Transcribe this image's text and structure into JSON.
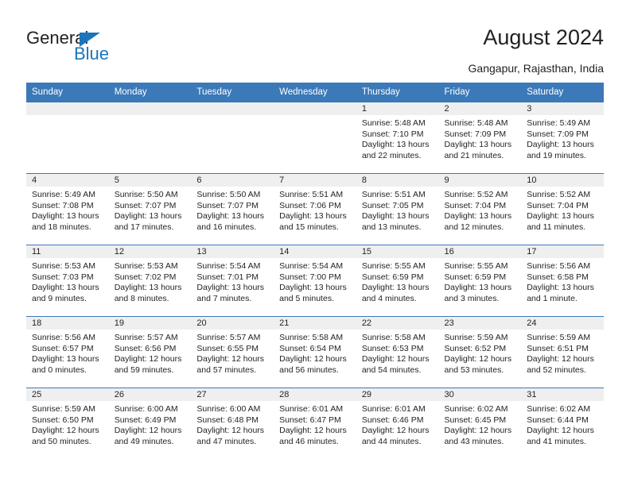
{
  "brand": {
    "name_top": "General",
    "name_bottom": "Blue",
    "accent_color": "#1b75bb"
  },
  "header": {
    "title": "August 2024",
    "subtitle": "Gangapur, Rajasthan, India"
  },
  "calendar": {
    "header_bg": "#3b79b8",
    "daynum_bg": "#efefef",
    "weekdays": [
      "Sunday",
      "Monday",
      "Tuesday",
      "Wednesday",
      "Thursday",
      "Friday",
      "Saturday"
    ],
    "weeks": [
      [
        {
          "day": "",
          "empty": true
        },
        {
          "day": "",
          "empty": true
        },
        {
          "day": "",
          "empty": true
        },
        {
          "day": "",
          "empty": true
        },
        {
          "day": "1",
          "sunrise": "Sunrise: 5:48 AM",
          "sunset": "Sunset: 7:10 PM",
          "daylight": "Daylight: 13 hours and 22 minutes."
        },
        {
          "day": "2",
          "sunrise": "Sunrise: 5:48 AM",
          "sunset": "Sunset: 7:09 PM",
          "daylight": "Daylight: 13 hours and 21 minutes."
        },
        {
          "day": "3",
          "sunrise": "Sunrise: 5:49 AM",
          "sunset": "Sunset: 7:09 PM",
          "daylight": "Daylight: 13 hours and 19 minutes."
        }
      ],
      [
        {
          "day": "4",
          "sunrise": "Sunrise: 5:49 AM",
          "sunset": "Sunset: 7:08 PM",
          "daylight": "Daylight: 13 hours and 18 minutes."
        },
        {
          "day": "5",
          "sunrise": "Sunrise: 5:50 AM",
          "sunset": "Sunset: 7:07 PM",
          "daylight": "Daylight: 13 hours and 17 minutes."
        },
        {
          "day": "6",
          "sunrise": "Sunrise: 5:50 AM",
          "sunset": "Sunset: 7:07 PM",
          "daylight": "Daylight: 13 hours and 16 minutes."
        },
        {
          "day": "7",
          "sunrise": "Sunrise: 5:51 AM",
          "sunset": "Sunset: 7:06 PM",
          "daylight": "Daylight: 13 hours and 15 minutes."
        },
        {
          "day": "8",
          "sunrise": "Sunrise: 5:51 AM",
          "sunset": "Sunset: 7:05 PM",
          "daylight": "Daylight: 13 hours and 13 minutes."
        },
        {
          "day": "9",
          "sunrise": "Sunrise: 5:52 AM",
          "sunset": "Sunset: 7:04 PM",
          "daylight": "Daylight: 13 hours and 12 minutes."
        },
        {
          "day": "10",
          "sunrise": "Sunrise: 5:52 AM",
          "sunset": "Sunset: 7:04 PM",
          "daylight": "Daylight: 13 hours and 11 minutes."
        }
      ],
      [
        {
          "day": "11",
          "sunrise": "Sunrise: 5:53 AM",
          "sunset": "Sunset: 7:03 PM",
          "daylight": "Daylight: 13 hours and 9 minutes."
        },
        {
          "day": "12",
          "sunrise": "Sunrise: 5:53 AM",
          "sunset": "Sunset: 7:02 PM",
          "daylight": "Daylight: 13 hours and 8 minutes."
        },
        {
          "day": "13",
          "sunrise": "Sunrise: 5:54 AM",
          "sunset": "Sunset: 7:01 PM",
          "daylight": "Daylight: 13 hours and 7 minutes."
        },
        {
          "day": "14",
          "sunrise": "Sunrise: 5:54 AM",
          "sunset": "Sunset: 7:00 PM",
          "daylight": "Daylight: 13 hours and 5 minutes."
        },
        {
          "day": "15",
          "sunrise": "Sunrise: 5:55 AM",
          "sunset": "Sunset: 6:59 PM",
          "daylight": "Daylight: 13 hours and 4 minutes."
        },
        {
          "day": "16",
          "sunrise": "Sunrise: 5:55 AM",
          "sunset": "Sunset: 6:59 PM",
          "daylight": "Daylight: 13 hours and 3 minutes."
        },
        {
          "day": "17",
          "sunrise": "Sunrise: 5:56 AM",
          "sunset": "Sunset: 6:58 PM",
          "daylight": "Daylight: 13 hours and 1 minute."
        }
      ],
      [
        {
          "day": "18",
          "sunrise": "Sunrise: 5:56 AM",
          "sunset": "Sunset: 6:57 PM",
          "daylight": "Daylight: 13 hours and 0 minutes."
        },
        {
          "day": "19",
          "sunrise": "Sunrise: 5:57 AM",
          "sunset": "Sunset: 6:56 PM",
          "daylight": "Daylight: 12 hours and 59 minutes."
        },
        {
          "day": "20",
          "sunrise": "Sunrise: 5:57 AM",
          "sunset": "Sunset: 6:55 PM",
          "daylight": "Daylight: 12 hours and 57 minutes."
        },
        {
          "day": "21",
          "sunrise": "Sunrise: 5:58 AM",
          "sunset": "Sunset: 6:54 PM",
          "daylight": "Daylight: 12 hours and 56 minutes."
        },
        {
          "day": "22",
          "sunrise": "Sunrise: 5:58 AM",
          "sunset": "Sunset: 6:53 PM",
          "daylight": "Daylight: 12 hours and 54 minutes."
        },
        {
          "day": "23",
          "sunrise": "Sunrise: 5:59 AM",
          "sunset": "Sunset: 6:52 PM",
          "daylight": "Daylight: 12 hours and 53 minutes."
        },
        {
          "day": "24",
          "sunrise": "Sunrise: 5:59 AM",
          "sunset": "Sunset: 6:51 PM",
          "daylight": "Daylight: 12 hours and 52 minutes."
        }
      ],
      [
        {
          "day": "25",
          "sunrise": "Sunrise: 5:59 AM",
          "sunset": "Sunset: 6:50 PM",
          "daylight": "Daylight: 12 hours and 50 minutes."
        },
        {
          "day": "26",
          "sunrise": "Sunrise: 6:00 AM",
          "sunset": "Sunset: 6:49 PM",
          "daylight": "Daylight: 12 hours and 49 minutes."
        },
        {
          "day": "27",
          "sunrise": "Sunrise: 6:00 AM",
          "sunset": "Sunset: 6:48 PM",
          "daylight": "Daylight: 12 hours and 47 minutes."
        },
        {
          "day": "28",
          "sunrise": "Sunrise: 6:01 AM",
          "sunset": "Sunset: 6:47 PM",
          "daylight": "Daylight: 12 hours and 46 minutes."
        },
        {
          "day": "29",
          "sunrise": "Sunrise: 6:01 AM",
          "sunset": "Sunset: 6:46 PM",
          "daylight": "Daylight: 12 hours and 44 minutes."
        },
        {
          "day": "30",
          "sunrise": "Sunrise: 6:02 AM",
          "sunset": "Sunset: 6:45 PM",
          "daylight": "Daylight: 12 hours and 43 minutes."
        },
        {
          "day": "31",
          "sunrise": "Sunrise: 6:02 AM",
          "sunset": "Sunset: 6:44 PM",
          "daylight": "Daylight: 12 hours and 41 minutes."
        }
      ]
    ]
  }
}
